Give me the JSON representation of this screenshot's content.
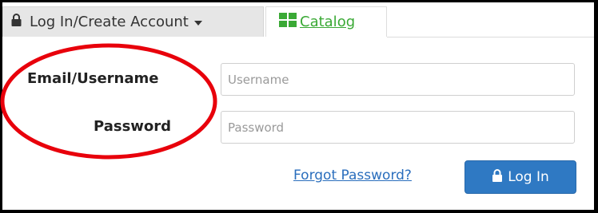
{
  "tabs": {
    "login": {
      "label": "Log In/Create Account",
      "icon": "lock-icon"
    },
    "catalog": {
      "label": "Catalog",
      "icon": "grid-icon"
    }
  },
  "form": {
    "email_label": "Email/Username",
    "password_label": "Password",
    "username_placeholder": "Username",
    "password_placeholder": "Password",
    "username_value": "",
    "password_value": ""
  },
  "actions": {
    "forgot_label": "Forgot Password?",
    "login_label": "Log In",
    "login_icon": "lock-icon"
  },
  "annotation": {
    "shape": "ellipse",
    "color": "#e8000b"
  },
  "colors": {
    "primary": "#2f79c3",
    "link": "#2a6ebd",
    "catalog": "#3aa935",
    "tab_bg": "#e6e6e6"
  }
}
